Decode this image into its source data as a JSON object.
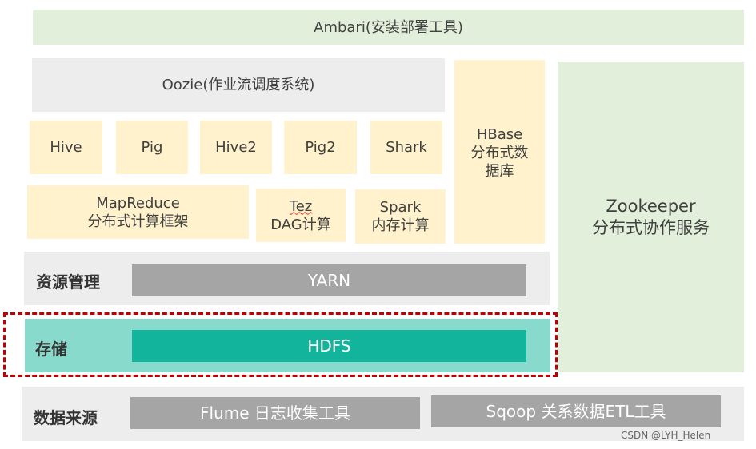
{
  "ambari": "Ambari(安装部署工具)",
  "oozie": "Oozie(作业流调度系统)",
  "hbase": {
    "name": "HBase",
    "desc": "分布式数据库"
  },
  "zookeeper": {
    "name": "Zookeeper",
    "desc": "分布式协作服务"
  },
  "tools": [
    "Hive",
    "Pig",
    "Hive2",
    "Pig2",
    "Shark"
  ],
  "mapreduce": {
    "name": "MapReduce",
    "desc": "分布式计算框架"
  },
  "tez": {
    "name": "Tez",
    "desc": "DAG计算"
  },
  "spark": {
    "name": "Spark",
    "desc": "内存计算"
  },
  "resource": {
    "label": "资源管理",
    "item": "YARN"
  },
  "storage": {
    "label": "存储",
    "item": "HDFS"
  },
  "source": {
    "label": "数据来源",
    "items": [
      "Flume 日志收集工具",
      "Sqoop 关系数据ETL工具"
    ]
  },
  "watermark": "CSDN @LYH_Helen",
  "colors": {
    "yellow": "#fff2cc",
    "green": "#e2efda",
    "gray": "#ededed",
    "dark_gray": "#a5a5a5",
    "teal_light": "#88dbcc",
    "teal": "#12b59b",
    "highlight": "#c00000"
  }
}
